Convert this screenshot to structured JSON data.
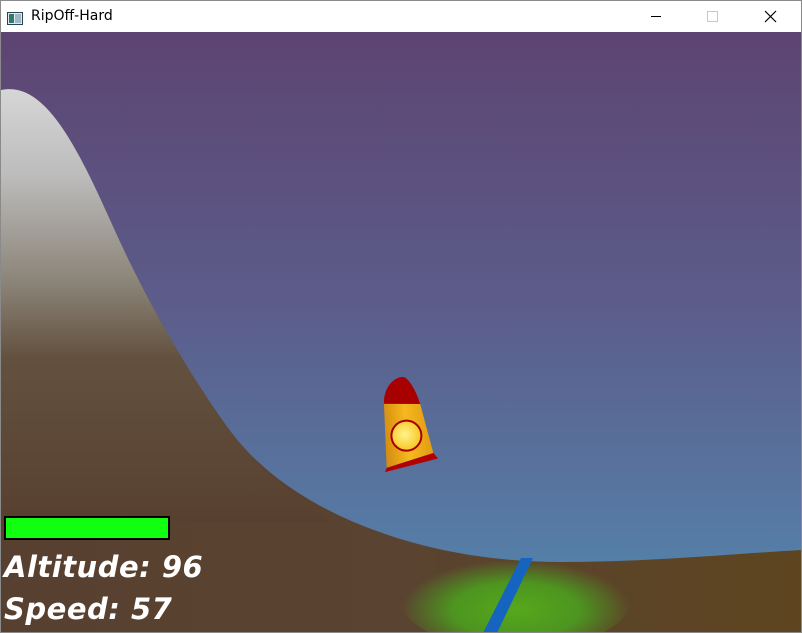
{
  "window": {
    "title": "RipOff-Hard",
    "icon": "app-window-icon",
    "controls": [
      "minimize-icon",
      "maximize-icon",
      "close-icon"
    ]
  },
  "hud": {
    "health_fraction": 1.0,
    "health_color": "#11ff11",
    "altitude_label": "Altitude:",
    "altitude_value": "96",
    "speed_label": "Speed:",
    "speed_value": "57"
  },
  "scene": {
    "sky_top_color": "#5d4472",
    "sky_bottom_color": "#5483ad",
    "ground_color": "#5c4230",
    "landing_pad_color": "#4a9a1e",
    "river_color": "#1565c0",
    "rocket_body_color": "#f4b21c",
    "rocket_nose_color": "#b00000",
    "rocket_window_color": "#ffe44d"
  }
}
